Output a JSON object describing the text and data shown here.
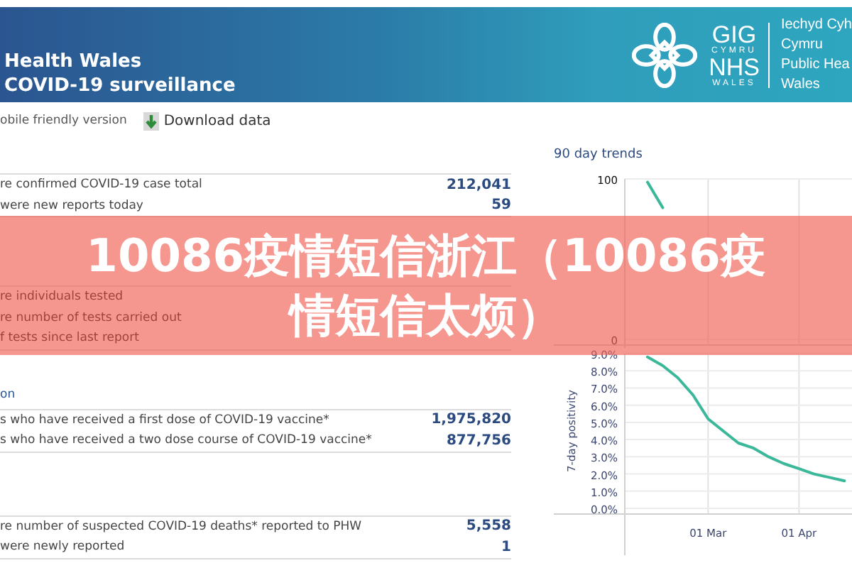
{
  "header": {
    "title_line_1": "Health Wales",
    "title_line_2": "COVID-19 surveillance",
    "logo": {
      "gig": "GIG",
      "cymru": "CYMRU",
      "nhs": "NHS",
      "wales": "WALES",
      "org_lines": [
        "Iechyd Cyh",
        "Cymru",
        "Public Hea",
        "Wales"
      ]
    }
  },
  "toolbar": {
    "mobile_link": "obile friendly version",
    "download": "Download data"
  },
  "sections": [
    {
      "rows": [
        {
          "label": "re confirmed COVID-19 case total",
          "value": "212,041"
        },
        {
          "label": "were new reports today",
          "value": "59"
        }
      ]
    },
    {
      "rows": [
        {
          "label": "re individuals tested"
        },
        {
          "label": "re number of tests carried out"
        },
        {
          "label": "f tests since last report"
        }
      ]
    },
    {
      "heading": "on",
      "rows": [
        {
          "label": "s who have received a first dose of COVID-19 vaccine*",
          "value": "1,975,820"
        },
        {
          "label": "s who have received a two dose course of COVID-19 vaccine*",
          "value": "877,756"
        }
      ]
    },
    {
      "rows": [
        {
          "label": "re number of suspected COVID-19 deaths* reported to PHW",
          "value": "5,558"
        },
        {
          "label": "were newly reported",
          "value": "1"
        }
      ]
    }
  ],
  "trends": {
    "title": "90 day trends",
    "charts": [
      {
        "chart_data": {
          "type": "line",
          "grid": true,
          "series": [
            {
              "color": "#3bb89a",
              "values": [
                null,
                98,
                82,
                null,
                null,
                null,
                null,
                null,
                null,
                null,
                null,
                null,
                null,
                null,
                null
              ]
            }
          ],
          "ylim": [
            0,
            100
          ],
          "yticks": [
            {
              "value": 0,
              "label": "0"
            },
            {
              "value": 100,
              "label": "100"
            }
          ]
        }
      },
      {
        "chart_data": {
          "type": "line",
          "grid": true,
          "ylabel": "7-day positivity",
          "categories": [
            null,
            null,
            null,
            null,
            null,
            "01 Mar",
            null,
            null,
            null,
            null,
            null,
            "01 Apr",
            null,
            null,
            null
          ],
          "series": [
            {
              "color": "#3bb89a",
              "values": [
                null,
                8.8,
                8.3,
                7.6,
                6.6,
                5.2,
                4.5,
                3.8,
                3.5,
                3.0,
                2.6,
                2.3,
                2.0,
                1.8,
                1.6
              ]
            }
          ],
          "ylim": [
            0,
            9
          ],
          "yticks": [
            {
              "value": 0,
              "label": "0.0%"
            },
            {
              "value": 1,
              "label": "1.0%"
            },
            {
              "value": 2,
              "label": "2.0%"
            },
            {
              "value": 3,
              "label": "3.0%"
            },
            {
              "value": 4,
              "label": "4.0%"
            },
            {
              "value": 5,
              "label": "5.0%"
            },
            {
              "value": 6,
              "label": "6.0%"
            },
            {
              "value": 7,
              "label": "7.0%"
            },
            {
              "value": 8,
              "label": "8.0%"
            },
            {
              "value": 9,
              "label": "9.0%"
            }
          ]
        }
      }
    ]
  },
  "banner": {
    "title_lines": [
      "10086疫情短信浙江（10086疫",
      "情短信太烦）"
    ]
  }
}
